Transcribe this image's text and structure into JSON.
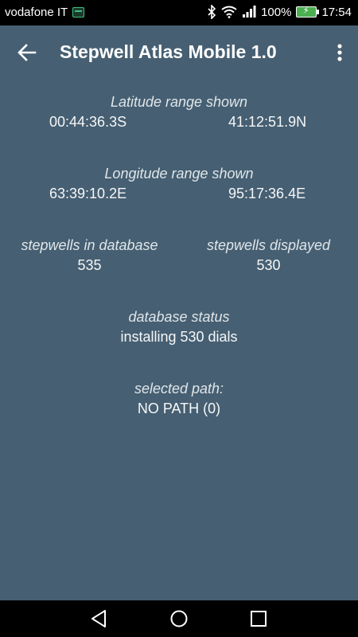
{
  "status_bar": {
    "carrier": "vodafone IT",
    "battery_percent": "100%",
    "time": "17:54",
    "icons": [
      "app-notification-icon",
      "bluetooth-icon",
      "wifi-icon",
      "signal-icon",
      "battery-charging-icon"
    ]
  },
  "app_bar": {
    "title": "Stepwell Atlas Mobile 1.0",
    "back_icon": "arrow-left-icon",
    "overflow_icon": "more-vert-icon"
  },
  "info": {
    "latitude": {
      "label": "Latitude range shown",
      "min": "00:44:36.3S",
      "max": "41:12:51.9N"
    },
    "longitude": {
      "label": "Longitude range shown",
      "min": "63:39:10.2E",
      "max": "95:17:36.4E"
    },
    "stepwells_in_database": {
      "label": "stepwells in database",
      "value": "535"
    },
    "stepwells_displayed": {
      "label": "stepwells displayed",
      "value": "530"
    },
    "database_status": {
      "label": "database status",
      "value": "installing 530 dials"
    },
    "selected_path": {
      "label": "selected path:",
      "value": "NO PATH (0)"
    }
  },
  "nav_bar": {
    "icons": [
      "back-triangle-icon",
      "home-circle-icon",
      "recents-square-icon"
    ]
  },
  "colors": {
    "background": "#465f72",
    "status_bar": "#000000",
    "nav_bar": "#000000",
    "text": "#f5f7f8"
  }
}
